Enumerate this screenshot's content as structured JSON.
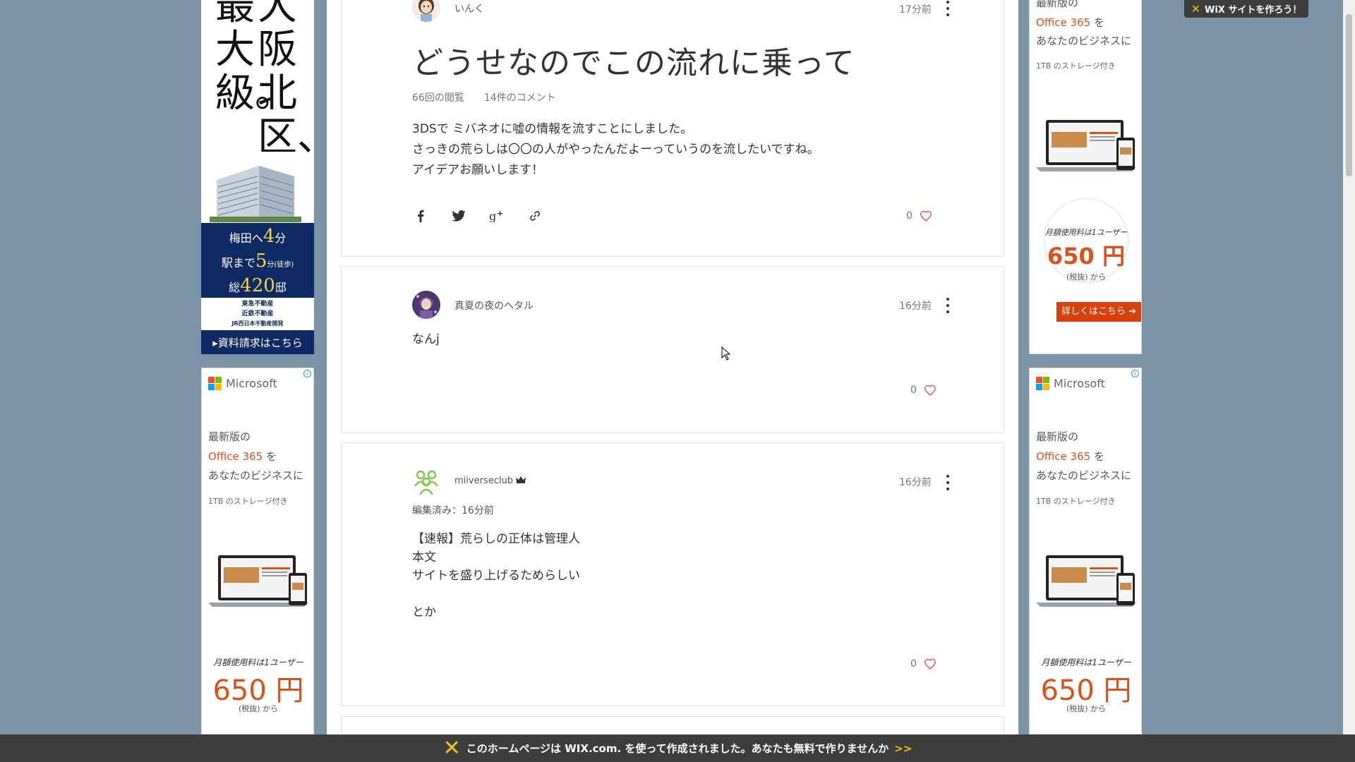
{
  "post": {
    "author": "いんく",
    "time": "17分前",
    "title": "どうせなのでこの流れに乗って",
    "views": "66回の閲覧",
    "comments": "14件のコメント",
    "body": [
      "3DSで ミバネオに嘘の情報を流すことにしました。",
      "さっきの荒らしは〇〇の人がやったんだよーっていうのを流したいですね。",
      "アイデアお願いします！"
    ],
    "likes": "0",
    "share_icons": [
      "facebook-icon",
      "twitter-icon",
      "google-plus-icon",
      "link-icon"
    ]
  },
  "comments": [
    {
      "author": "真夏の夜のヘタル",
      "time": "16分前",
      "body": [
        "なんj"
      ],
      "likes": "0"
    },
    {
      "author": "miiverseclub",
      "time": "16分前",
      "edited": "編集済み：16分前",
      "body": [
        "【速報】荒らしの正体は管理人",
        "本文",
        "サイトを盛り上げるためらしい",
        "",
        "とか"
      ],
      "likes": "0"
    }
  ],
  "ads": {
    "osaka": {
      "headline_col1": "最大級。",
      "headline_col2": "大阪北区、",
      "rows": [
        {
          "pre": "梅田へ",
          "num": "4",
          "post": "分"
        },
        {
          "pre": "駅まで",
          "num": "5",
          "post": "分(徒歩)"
        },
        {
          "pre": "総",
          "num": "420",
          "post": "邸"
        }
      ],
      "logos": [
        "東急不動産",
        "近鉄不動産",
        "JR西日本不動産開発"
      ],
      "cta": "▸資料請求はこちら"
    },
    "microsoft": {
      "brand": "Microsoft",
      "line1": "最新版の",
      "line2_orange": "Office 365",
      "line2_rest": " を",
      "line3": "あなたのビジネスに",
      "storage": "1TB のストレージ付き",
      "price_label": "月額使用料は1ユーザー",
      "price": "650 円",
      "tax": "(税抜) から",
      "cta": "詳しくはこちら ➔"
    }
  },
  "wix": {
    "badge": "WiX サイトを作ろう！",
    "bar_text": "このホームページは WIX.com. を使って作成されました。あなたも無料で作りませんか",
    "bar_arrows": ">>"
  },
  "colors": {
    "background": "#7b93a6",
    "heart": "#e05a5a",
    "office_orange": "#d8531c",
    "wix_dark": "#3d3d3d",
    "wix_yellow": "#f2c40f"
  }
}
